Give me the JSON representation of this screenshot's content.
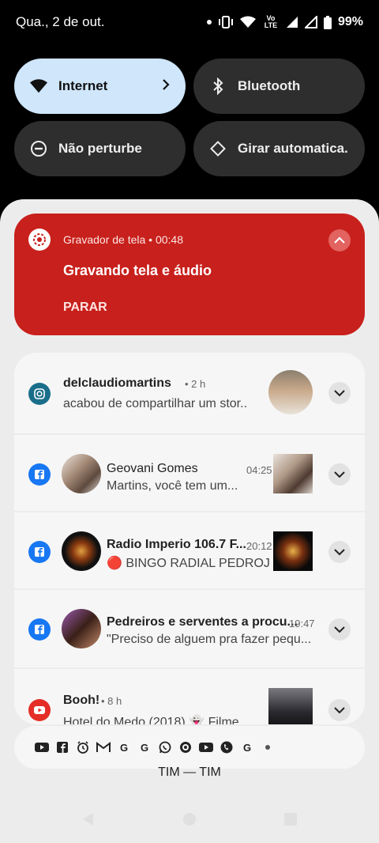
{
  "status_bar": {
    "date": "Qua., 2 de out.",
    "battery": "99%",
    "volte": "Vo LTE"
  },
  "quick_tiles": [
    {
      "label": "Internet",
      "icon": "wifi-icon",
      "active": true
    },
    {
      "label": "Bluetooth",
      "icon": "bluetooth-icon",
      "active": false
    },
    {
      "label": "Não perturbe",
      "icon": "do-not-disturb-icon",
      "active": false
    },
    {
      "label": "Girar automatica..",
      "icon": "auto-rotate-icon",
      "active": false
    }
  ],
  "recording": {
    "app": "Gravador de tela • 00:48",
    "title": "Gravando tela e áudio",
    "action": "PARAR"
  },
  "notifications": [
    {
      "app_icon": "instagram-icon",
      "title": "delclaudiomartins",
      "time": "• 2 h",
      "text": "acabou de compartilhar um stor.."
    },
    {
      "app_icon": "facebook-icon",
      "title": "Geovani Gomes",
      "time": "04:25",
      "text": "Martins, você tem um..."
    },
    {
      "app_icon": "facebook-icon",
      "title": "Radio Imperio 106.7 F...",
      "time": "20:12",
      "text": "🔴 BINGO RADIAL PEDROJ..."
    },
    {
      "app_icon": "facebook-icon",
      "title": "Pedreiros e serventes a procu...",
      "time": "19:47",
      "text": "\"Preciso de alguem pra fazer pequ..."
    },
    {
      "app_icon": "youtube-icon",
      "title": "Booh!",
      "time": "• 8 h",
      "text": "Hotel do Medo (2018) 👻 Filme..."
    }
  ],
  "icon_strip": [
    "youtube-icon",
    "facebook-icon",
    "alarm-icon",
    "gmail-icon",
    "google-icon",
    "google-icon",
    "whatsapp-icon",
    "circle-app-icon",
    "youtube-icon",
    "phone-icon",
    "google-icon",
    "more-dot-icon"
  ],
  "carrier": "TIM — TIM",
  "colors": {
    "accent_tile": "#cfe6fb",
    "recording": "#c8201c",
    "facebook": "#1877f2",
    "youtube": "#e52d27",
    "instagram": "#1a6e8a"
  }
}
